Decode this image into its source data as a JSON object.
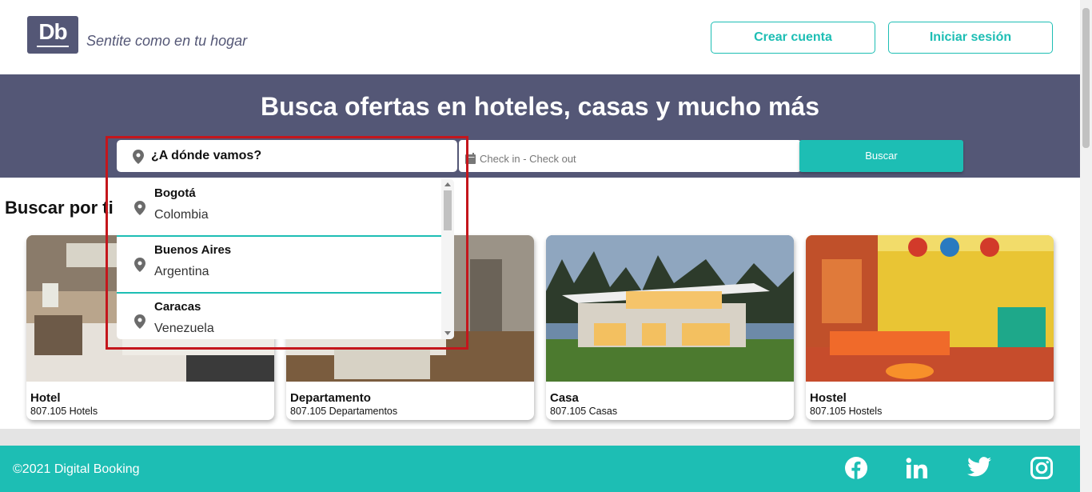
{
  "header": {
    "logo_text": "Db",
    "tagline": "Sentite como en tu hogar",
    "create_account": "Crear cuenta",
    "login": "Iniciar sesión"
  },
  "hero": {
    "title": "Busca ofertas en hoteles, casas y mucho más",
    "destination_value": "¿A dónde vamos?",
    "dates_placeholder": "Check in - Check out",
    "search_button": "Buscar"
  },
  "dropdown": {
    "items": [
      {
        "city": "Bogotá",
        "country": "Colombia"
      },
      {
        "city": "Buenos Aires",
        "country": "Argentina"
      },
      {
        "city": "Caracas",
        "country": "Venezuela"
      }
    ]
  },
  "categories": {
    "title": "Buscar por tipo de alojamiento",
    "title_visible": "Buscar por ti",
    "cards": [
      {
        "name": "Hotel",
        "count": "807.105 Hotels"
      },
      {
        "name": "Departamento",
        "count": "807.105 Departamentos"
      },
      {
        "name": "Casa",
        "count": "807.105 Casas"
      },
      {
        "name": "Hostel",
        "count": "807.105 Hostels"
      }
    ]
  },
  "footer": {
    "copyright": "©2021 Digital Booking",
    "social": [
      "facebook-icon",
      "linkedin-icon",
      "twitter-icon",
      "instagram-icon"
    ]
  },
  "colors": {
    "primary": "#1dbeb4",
    "secondary": "#545776",
    "highlight": "#c4161c"
  }
}
